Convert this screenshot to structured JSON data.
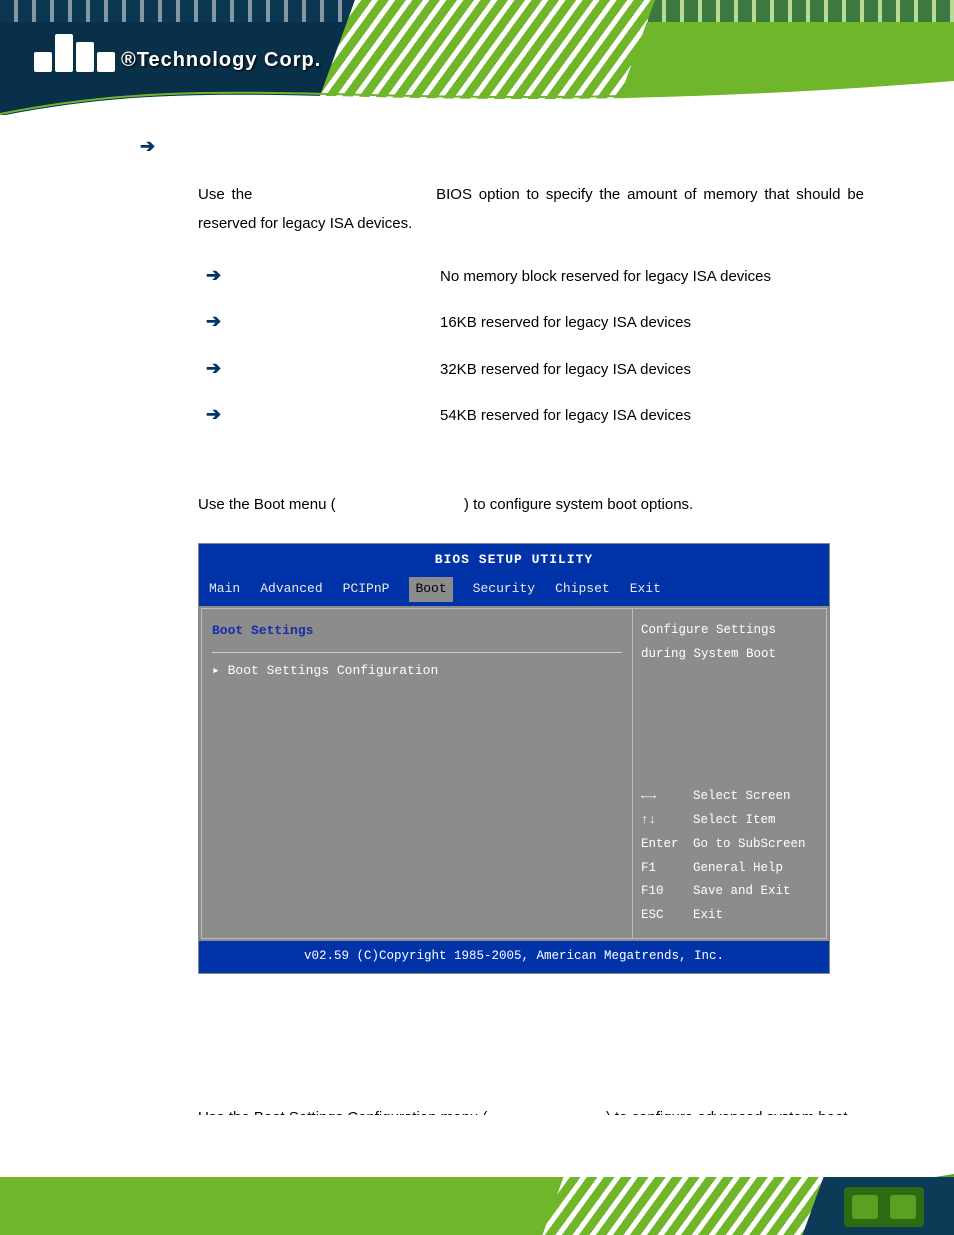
{
  "logo": {
    "text": "®Technology Corp."
  },
  "option_heading_arrow": "➔",
  "intro": {
    "pre": "Use  the",
    "post": "BIOS  option  to  specify  the  amount  of  memory  that should be reserved for legacy ISA devices."
  },
  "options": [
    {
      "desc": "No memory block reserved for legacy ISA devices"
    },
    {
      "desc": "16KB reserved for legacy ISA devices"
    },
    {
      "desc": "32KB reserved for legacy ISA devices"
    },
    {
      "desc": "54KB reserved for legacy ISA devices"
    }
  ],
  "boot_para": {
    "pre": "Use the Boot menu (",
    "post": ") to configure system boot options."
  },
  "bios": {
    "title": "BIOS SETUP UTILITY",
    "tabs": [
      "Main",
      "Advanced",
      "PCIPnP",
      "Boot",
      "Security",
      "Chipset",
      "Exit"
    ],
    "selected_tab": "Boot",
    "left_heading": "Boot Settings",
    "left_item": "▸ Boot Settings Configuration",
    "right_top1": "Configure Settings",
    "right_top2": "during System Boot",
    "help": [
      {
        "key": "←→",
        "label": "Select Screen"
      },
      {
        "key": "↑↓",
        "label": "Select Item"
      },
      {
        "key": "Enter",
        "label": "Go to SubScreen"
      },
      {
        "key": "F1",
        "label": "General Help"
      },
      {
        "key": "F10",
        "label": "Save and Exit"
      },
      {
        "key": "ESC",
        "label": "Exit"
      }
    ],
    "footer": "v02.59 (C)Copyright 1985-2005, American Megatrends, Inc."
  },
  "bottom": {
    "pre": "Use the Boot Settings Configuration menu (",
    "post": ") to configure advanced system boot options."
  }
}
